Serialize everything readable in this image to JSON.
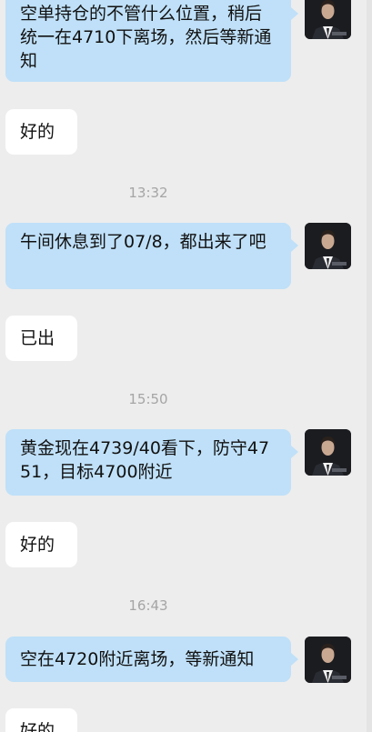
{
  "chat": {
    "messages": [
      {
        "side": "out",
        "text": "空单持仓的不管什么位置，稍后统一在4710下离场，然后等新通知"
      },
      {
        "side": "in",
        "text": "好的"
      },
      {
        "type": "time",
        "text": "13:32"
      },
      {
        "side": "out",
        "text": "午间休息到了07/8，都出来了吧"
      },
      {
        "side": "in",
        "text": "已出"
      },
      {
        "type": "time",
        "text": "15:50"
      },
      {
        "side": "out",
        "text": "黄金现在4739/40看下，防守4751，目标4700附近"
      },
      {
        "side": "in",
        "text": "好的"
      },
      {
        "type": "time",
        "text": "16:43"
      },
      {
        "side": "out",
        "text": "空在4720附近离场，等新通知"
      },
      {
        "side": "in",
        "text": "好的"
      }
    ]
  },
  "avatar_icon": "man-in-suit-avatar",
  "colors": {
    "background": "#ededed",
    "outgoing_bubble": "#bfe0f8",
    "incoming_bubble": "#ffffff",
    "timestamp_text": "#a5a5a5"
  }
}
